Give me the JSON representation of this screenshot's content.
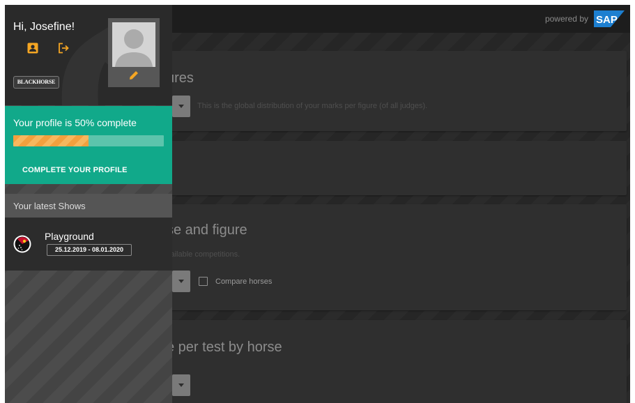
{
  "topbar": {
    "powered_by": "powered by",
    "sap_logo_text": "SAP"
  },
  "sidebar": {
    "greeting": "Hi, Josefine!",
    "profile_icon": "account-box-icon",
    "logout_icon": "logout-icon",
    "brand_label": "BLACKHORSE",
    "avatar_icon": "person-silhouette-icon",
    "edit_icon": "pencil-icon",
    "progress": {
      "text": "Your profile is 50% complete",
      "percent": 50,
      "button_label": "COMPLETE YOUR PROFILE"
    },
    "latest_shows": {
      "header": "Your latest Shows",
      "items": [
        {
          "name": "Playground",
          "dates": "25.12.2019 - 08.01.2020",
          "icon": "show-logo-icon"
        }
      ]
    }
  },
  "cards": [
    {
      "title": "ures",
      "description": "This is the global distribution of your marks per figure (of all judges)."
    },
    {
      "title": "",
      "description": ""
    },
    {
      "title": "se and figure",
      "description": "vailable competitions.",
      "checkbox_label": "Compare horses"
    },
    {
      "title": "e per test by horse",
      "description": ""
    }
  ],
  "colors": {
    "accent_teal": "#11a98a",
    "progress_orange": "#f3a03e",
    "icon_orange": "#f5a623",
    "sap_blue": "#1d7fd0"
  }
}
